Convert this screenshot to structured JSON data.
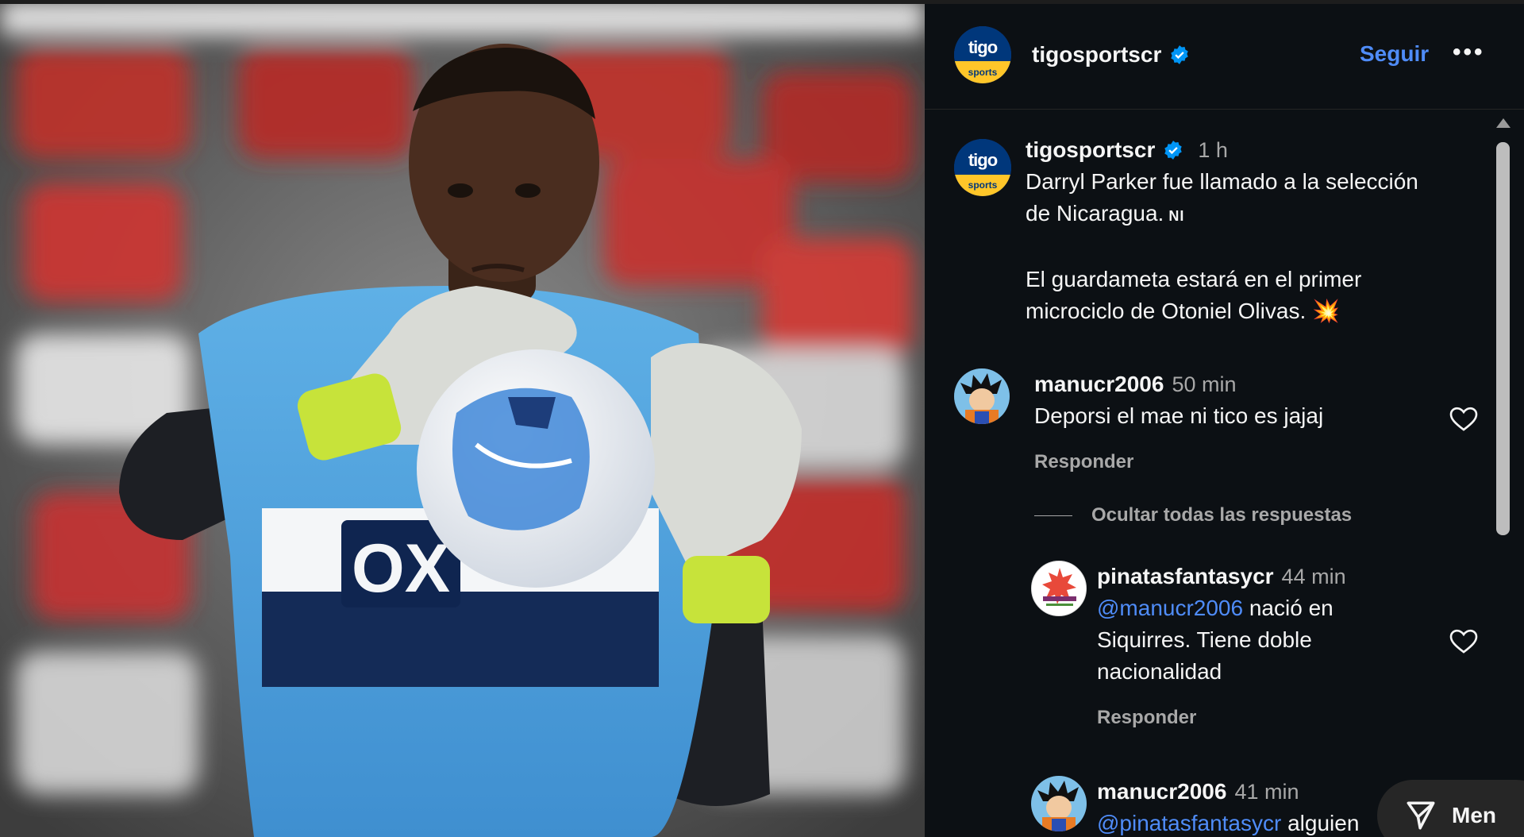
{
  "post": {
    "author": "tigosportscr",
    "avatar_top": "tigo",
    "avatar_bottom": "sports",
    "follow_label": "Seguir",
    "more_label": "•••",
    "caption": {
      "time": "1 h",
      "line1": "Darryl Parker fue llamado a la selección",
      "line2": "de Nicaragua.",
      "flag": "NI",
      "line3": "El guardameta estará en el primer",
      "line4": "microciclo de Otoniel Olivas.",
      "emoji": "💥"
    }
  },
  "comments": [
    {
      "user": "manucr2006",
      "time": "50 min",
      "text": "Deporsi el mae ni tico es jajaj",
      "reply_label": "Responder"
    }
  ],
  "hide_replies_label": "Ocultar todas las respuestas",
  "replies": [
    {
      "user": "pinatasfantasycr",
      "time": "44 min",
      "mention": "@manucr2006",
      "text_after_mention": " nació en",
      "line2": "Siquirres. Tiene doble",
      "line3": "nacionalidad",
      "reply_label": "Responder"
    },
    {
      "user": "manucr2006",
      "time": "41 min",
      "mention": "@pinatasfantasycr",
      "text_after_mention": " alguien"
    }
  ],
  "messages_button": {
    "label": "Men"
  },
  "photo": {
    "jersey_text": "OX"
  },
  "colors": {
    "accent": "#4f8cf8",
    "panel_bg": "#0c1014",
    "secondary_text": "#a8a8a8"
  }
}
